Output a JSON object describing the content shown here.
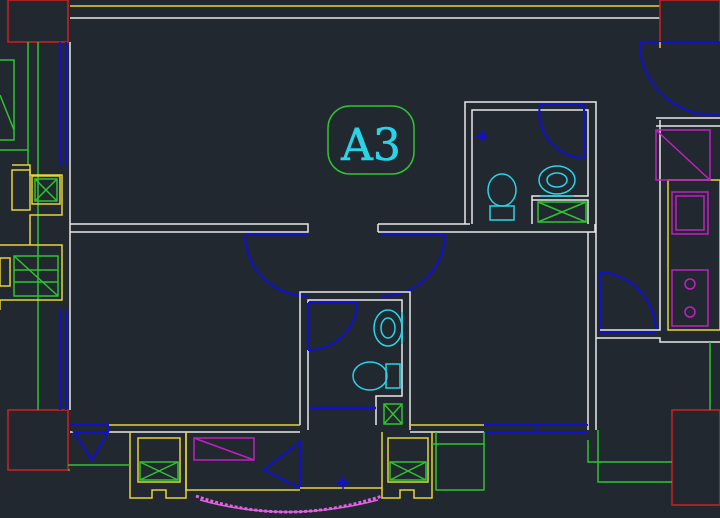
{
  "drawing": {
    "background": "#212830",
    "colors": {
      "wall": "#e8e8e8",
      "yellow": "#e6d23c",
      "green": "#2fc42f",
      "blue": "#1010d0",
      "cyan": "#2ad4e6",
      "red": "#d02020",
      "magenta": "#c020c0",
      "pink": "#e060e0"
    }
  },
  "room_label": {
    "text": "A3",
    "text_color": "#2ad4e6",
    "frame_color": "#2fc42f"
  }
}
